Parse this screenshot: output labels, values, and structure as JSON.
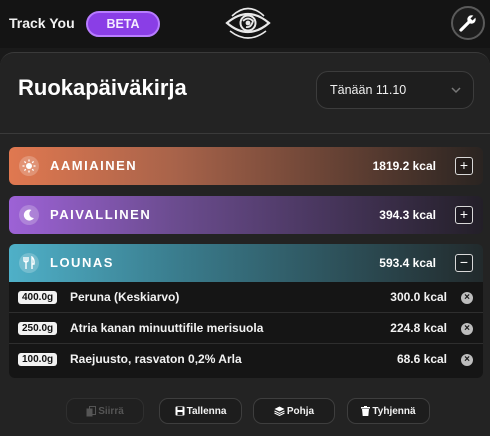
{
  "header": {
    "app_name": "Track You",
    "beta_label": "BETA"
  },
  "page": {
    "title": "Ruokapäiväkirja",
    "date_selected": "Tänään 11.10"
  },
  "meals": [
    {
      "name": "AAMIAINEN",
      "kcal": "1819.2 kcal",
      "toggle": "+",
      "icon": "sun-icon",
      "color": "#e07850"
    },
    {
      "name": "PAIVALLINEN",
      "kcal": "394.3 kcal",
      "toggle": "+",
      "icon": "moon-icon",
      "color": "#9d62d6"
    },
    {
      "name": "LOUNAS",
      "kcal": "593.4 kcal",
      "toggle": "−",
      "icon": "cutlery-icon",
      "color": "#4fb0c8"
    }
  ],
  "foods": [
    {
      "grams": "400.0g",
      "name": "Peruna (Keskiarvo)",
      "kcal": "300.0 kcal"
    },
    {
      "grams": "250.0g",
      "name": "Atria kanan minuuttifile merisuola",
      "kcal": "224.8 kcal"
    },
    {
      "grams": "100.0g",
      "name": "Raejuusto, rasvaton 0,2% Arla",
      "kcal": "68.6 kcal"
    }
  ],
  "actions": {
    "move": "Siirrä",
    "save": "Tallenna",
    "template": "Pohja",
    "clear": "Tyhjennä"
  }
}
